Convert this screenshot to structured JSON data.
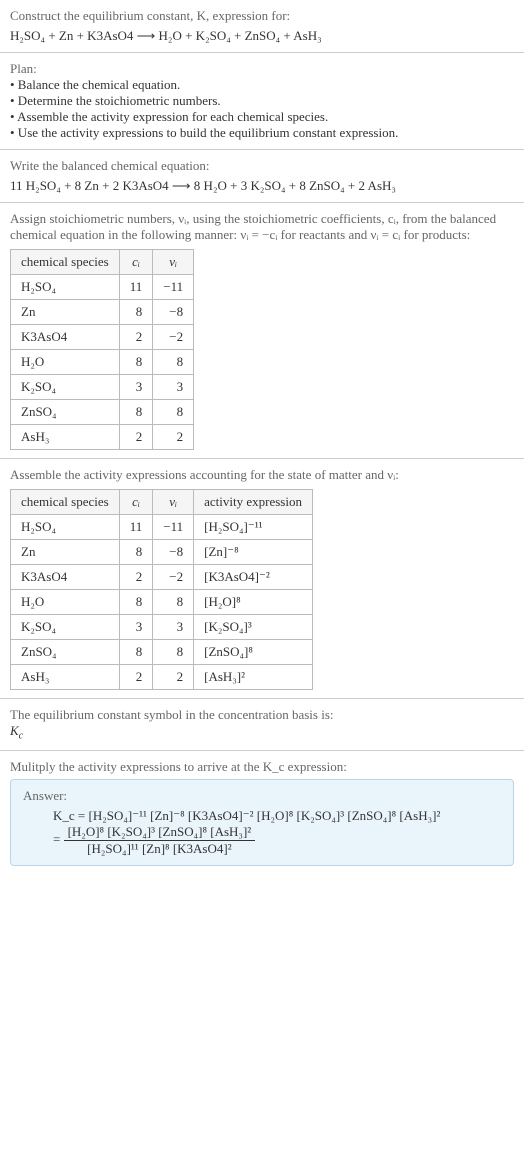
{
  "header": {
    "construct_line": "Construct the equilibrium constant, K, expression for:",
    "unbalanced_eq": "H₂SO₄ + Zn + K3AsO4  ⟶  H₂O + K₂SO₄ + ZnSO₄ + AsH₃"
  },
  "plan": {
    "title": "Plan:",
    "items": [
      "• Balance the chemical equation.",
      "• Determine the stoichiometric numbers.",
      "• Assemble the activity expression for each chemical species.",
      "• Use the activity expressions to build the equilibrium constant expression."
    ]
  },
  "balanced": {
    "title": "Write the balanced chemical equation:",
    "eq": "11 H₂SO₄ + 8 Zn + 2 K3AsO4  ⟶  8 H₂O + 3 K₂SO₄ + 8 ZnSO₄ + 2 AsH₃"
  },
  "stoich": {
    "title": "Assign stoichiometric numbers, νᵢ, using the stoichiometric coefficients, cᵢ, from the balanced chemical equation in the following manner: νᵢ = −cᵢ for reactants and νᵢ = cᵢ for products:",
    "headers": [
      "chemical species",
      "cᵢ",
      "νᵢ"
    ],
    "rows": [
      {
        "species": "H₂SO₄",
        "c": "11",
        "nu": "−11"
      },
      {
        "species": "Zn",
        "c": "8",
        "nu": "−8"
      },
      {
        "species": "K3AsO4",
        "c": "2",
        "nu": "−2"
      },
      {
        "species": "H₂O",
        "c": "8",
        "nu": "8"
      },
      {
        "species": "K₂SO₄",
        "c": "3",
        "nu": "3"
      },
      {
        "species": "ZnSO₄",
        "c": "8",
        "nu": "8"
      },
      {
        "species": "AsH₃",
        "c": "2",
        "nu": "2"
      }
    ]
  },
  "activity": {
    "title": "Assemble the activity expressions accounting for the state of matter and νᵢ:",
    "headers": [
      "chemical species",
      "cᵢ",
      "νᵢ",
      "activity expression"
    ],
    "rows": [
      {
        "species": "H₂SO₄",
        "c": "11",
        "nu": "−11",
        "expr": "[H₂SO₄]⁻¹¹"
      },
      {
        "species": "Zn",
        "c": "8",
        "nu": "−8",
        "expr": "[Zn]⁻⁸"
      },
      {
        "species": "K3AsO4",
        "c": "2",
        "nu": "−2",
        "expr": "[K3AsO4]⁻²"
      },
      {
        "species": "H₂O",
        "c": "8",
        "nu": "8",
        "expr": "[H₂O]⁸"
      },
      {
        "species": "K₂SO₄",
        "c": "3",
        "nu": "3",
        "expr": "[K₂SO₄]³"
      },
      {
        "species": "ZnSO₄",
        "c": "8",
        "nu": "8",
        "expr": "[ZnSO₄]⁸"
      },
      {
        "species": "AsH₃",
        "c": "2",
        "nu": "2",
        "expr": "[AsH₃]²"
      }
    ]
  },
  "symbol": {
    "title": "The equilibrium constant symbol in the concentration basis is:",
    "value": "K_c"
  },
  "multiply": {
    "title": "Mulitply the activity expressions to arrive at the K_c expression:"
  },
  "answer": {
    "label": "Answer:",
    "line1": "K_c = [H₂SO₄]⁻¹¹ [Zn]⁻⁸ [K3AsO4]⁻² [H₂O]⁸ [K₂SO₄]³ [ZnSO₄]⁸ [AsH₃]²",
    "frac_num": "[H₂O]⁸ [K₂SO₄]³ [ZnSO₄]⁸ [AsH₃]²",
    "frac_den": "[H₂SO₄]¹¹ [Zn]⁸ [K3AsO4]²",
    "equals": " = "
  }
}
